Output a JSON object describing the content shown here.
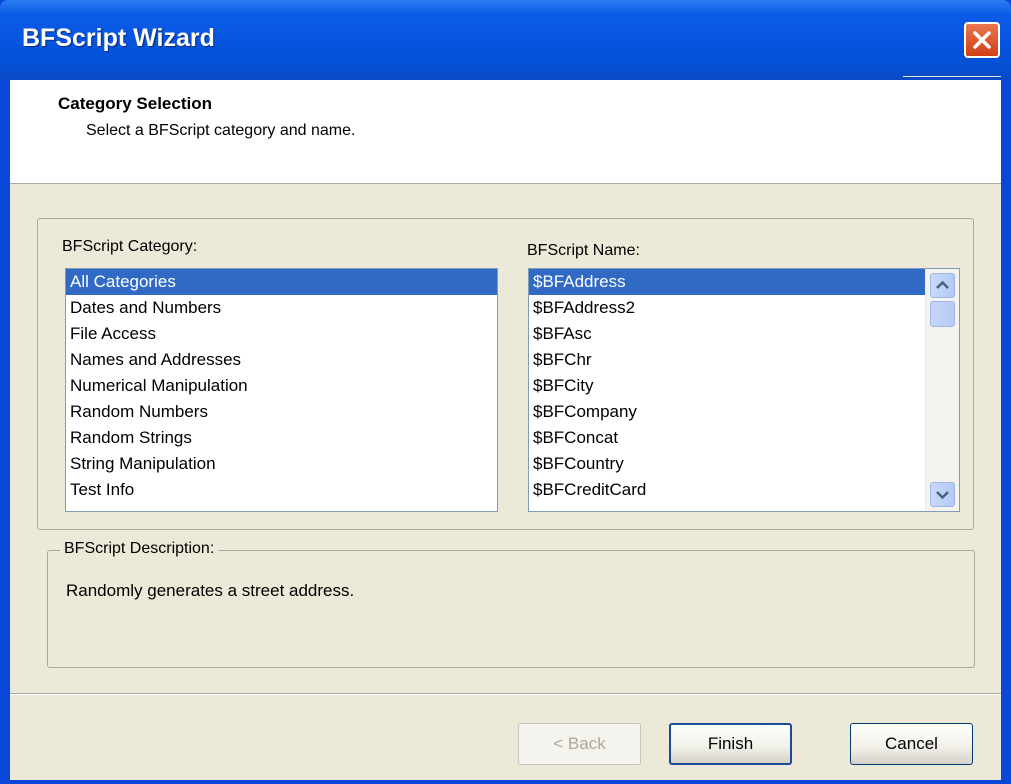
{
  "window": {
    "title": "BFScript Wizard",
    "close_icon": "close-icon"
  },
  "header": {
    "title": "Category Selection",
    "subtitle": "Select a BFScript category and name."
  },
  "category": {
    "label": "BFScript Category:",
    "items": [
      {
        "label": "All Categories",
        "selected": true
      },
      {
        "label": "Dates and Numbers"
      },
      {
        "label": "File Access"
      },
      {
        "label": "Names and Addresses"
      },
      {
        "label": "Numerical Manipulation"
      },
      {
        "label": "Random Numbers"
      },
      {
        "label": "Random Strings"
      },
      {
        "label": "String Manipulation"
      },
      {
        "label": "Test Info"
      }
    ]
  },
  "name": {
    "label": "BFScript Name:",
    "items": [
      {
        "label": "$BFAddress",
        "selected": true
      },
      {
        "label": "$BFAddress2"
      },
      {
        "label": "$BFAsc"
      },
      {
        "label": "$BFChr"
      },
      {
        "label": "$BFCity"
      },
      {
        "label": "$BFCompany"
      },
      {
        "label": "$BFConcat"
      },
      {
        "label": "$BFCountry"
      },
      {
        "label": "$BFCreditCard"
      }
    ]
  },
  "description": {
    "label": "BFScript Description:",
    "text": "Randomly generates a street address."
  },
  "buttons": {
    "back": "< Back",
    "finish": "Finish",
    "cancel": "Cancel"
  },
  "colors": {
    "titlebar": "#0654e0",
    "selection": "#316ac5",
    "dialog_bg": "#ece9d8"
  }
}
